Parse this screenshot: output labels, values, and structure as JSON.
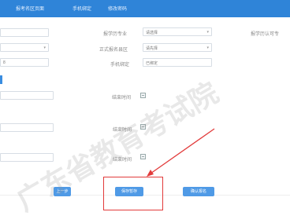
{
  "header": {
    "tabs": [
      "报考名区页面",
      "手机绑定",
      "修改密码"
    ]
  },
  "form": {
    "label_major": "报学历专业",
    "value_major": "请选择",
    "label_region": "正式报名县区",
    "value_region": "请先择",
    "label_phone": "手机绑定",
    "value_phone": "已绑定",
    "label_school_region": "报学历认可专",
    "value_left_row3": "8",
    "label_end_time_1": "结束时间",
    "label_end_time_2": "结束时间",
    "label_end_time_3": "结束时间"
  },
  "buttons": {
    "prev_label": "上一步",
    "save_label": "保存暂存",
    "confirm_label": "确认报名"
  },
  "watermark": {
    "text_line1": "广东省教育考试院"
  },
  "icons": {
    "calendar": "calendar-icon",
    "caret": "caret-down-icon"
  },
  "colors": {
    "topbar": "#2f84d8",
    "button": "#4f9ae6",
    "highlight": "#e23b3b"
  }
}
